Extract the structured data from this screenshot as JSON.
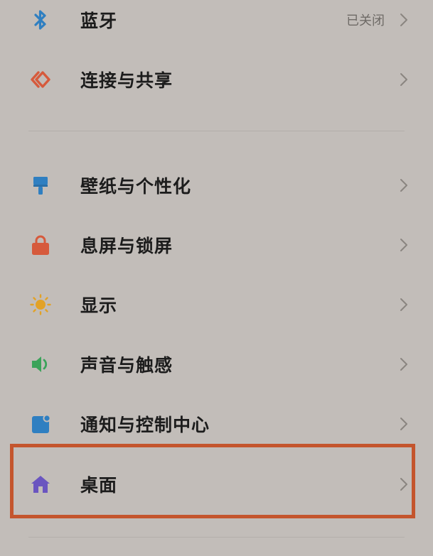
{
  "settings": {
    "bluetooth": {
      "label": "蓝牙",
      "value": "已关闭",
      "icon": "bluetooth-icon"
    },
    "connection": {
      "label": "连接与共享",
      "icon": "connection-share-icon"
    },
    "wallpaper": {
      "label": "壁纸与个性化",
      "icon": "paint-brush-icon"
    },
    "lockscreen": {
      "label": "息屏与锁屏",
      "icon": "lock-icon"
    },
    "display": {
      "label": "显示",
      "icon": "sun-icon"
    },
    "sound": {
      "label": "声音与触感",
      "icon": "speaker-icon"
    },
    "notifications": {
      "label": "通知与控制中心",
      "icon": "notification-icon"
    },
    "home": {
      "label": "桌面",
      "icon": "home-icon"
    }
  },
  "colors": {
    "background": "#c2bdb9",
    "highlight": "#c4552d",
    "bluetooth": "#2f7fc1",
    "connection": "#d65a3c",
    "wallpaper": "#2f7fc1",
    "lock": "#d65a3c",
    "sun": "#e2a227",
    "speaker": "#3ba35a",
    "notification": "#2f7fc1",
    "home": "#6a55c0"
  }
}
